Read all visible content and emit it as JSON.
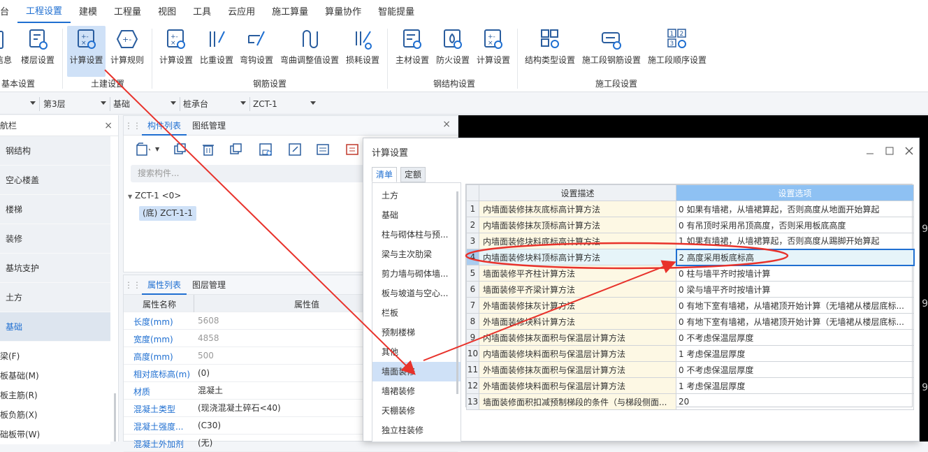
{
  "menubar": [
    "台",
    "工程设置",
    "建模",
    "工程量",
    "视图",
    "工具",
    "云应用",
    "施工算量",
    "算量协作",
    "智能提量"
  ],
  "ribbon": {
    "buttons": [
      "信息",
      "楼层设置",
      "计算设置",
      "计算规则",
      "计算设置",
      "比重设置",
      "弯钩设置",
      "弯曲调整值设置",
      "损耗设置",
      "主材设置",
      "防火设置",
      "计算设置",
      "结构类型设置",
      "施工段钢筋设置",
      "施工段顺序设置"
    ],
    "groups": [
      "基本设置",
      "土建设置",
      "钢筋设置",
      "钢结构设置",
      "施工段设置"
    ]
  },
  "dropdowns": [
    "",
    "第3层",
    "基础",
    "桩承台",
    "ZCT-1"
  ],
  "nav": {
    "title": "航栏",
    "items": [
      "钢结构",
      "空心楼盖",
      "楼梯",
      "装修",
      "基坑支护",
      "土方",
      "基础"
    ],
    "subitems": [
      "梁(F)",
      "板基础(M)",
      "板主筋(R)",
      "板负筋(X)",
      "础板带(W)"
    ]
  },
  "component_panel": {
    "tabs": [
      "构件列表",
      "图纸管理"
    ],
    "search_placeholder": "搜索构件...",
    "tree_root": "ZCT-1 <0>",
    "tree_child": "(底) ZCT-1-1"
  },
  "property_panel": {
    "tabs": [
      "属性列表",
      "图层管理"
    ],
    "headers": [
      "属性名称",
      "属性值"
    ],
    "rows": [
      {
        "name": "长度(mm)",
        "value": "5608"
      },
      {
        "name": "宽度(mm)",
        "value": "4858"
      },
      {
        "name": "高度(mm)",
        "value": "500"
      },
      {
        "name": "相对底标高(m)",
        "value": "(0)"
      },
      {
        "name": "材质",
        "value": "混凝土"
      },
      {
        "name": "混凝土类型",
        "value": "(现浇混凝土碎石<40)"
      },
      {
        "name": "混凝土强度...",
        "value": "(C30)"
      },
      {
        "name": "混凝土外加剂",
        "value": "(无)"
      }
    ]
  },
  "dialog": {
    "title": "计算设置",
    "tabs": [
      "清单",
      "定额"
    ],
    "categories": [
      "土方",
      "基础",
      "柱与砌体柱与预...",
      "梁与主次肋梁",
      "剪力墙与砌体墙...",
      "板与坡道与空心...",
      "栏板",
      "预制楼梯",
      "其他",
      "墙面装修",
      "墙裙装修",
      "天棚装修",
      "独立柱装修"
    ],
    "selected_category": "墙面装修",
    "headers": [
      "设置描述",
      "设置选项"
    ],
    "rows": [
      {
        "n": "1",
        "desc": "内墙面装修抹灰底标高计算方法",
        "opt": "0 如果有墙裙，从墙裙算起，否则高度从地面开始算起"
      },
      {
        "n": "2",
        "desc": "内墙面装修抹灰顶标高计算方法",
        "opt": "0 有吊顶时采用吊顶高度，否则采用板底高度"
      },
      {
        "n": "3",
        "desc": "内墙面装修块料底标高计算方法",
        "opt": "1 如果有墙裙，从墙裙算起，否则高度从踢脚开始算起"
      },
      {
        "n": "4",
        "desc": "内墙面装修块料顶标高计算方法",
        "opt": "2 高度采用板底标高"
      },
      {
        "n": "5",
        "desc": "墙面装修平齐柱计算方法",
        "opt": "0 柱与墙平齐时按墙计算"
      },
      {
        "n": "6",
        "desc": "墙面装修平齐梁计算方法",
        "opt": "0 梁与墙平齐时按墙计算"
      },
      {
        "n": "7",
        "desc": "外墙面装修抹灰计算方法",
        "opt": "0 有地下室有墙裙，从墙裙顶开始计算（无墙裙从楼层底标..."
      },
      {
        "n": "8",
        "desc": "外墙面装修块料计算方法",
        "opt": "0 有地下室有墙裙，从墙裙顶开始计算（无墙裙从楼层底标..."
      },
      {
        "n": "9",
        "desc": "内墙面装修抹灰面积与保温层计算方法",
        "opt": "0 不考虑保温层厚度"
      },
      {
        "n": "10",
        "desc": "内墙面装修块料面积与保温层计算方法",
        "opt": "1 考虑保温层厚度"
      },
      {
        "n": "11",
        "desc": "外墙面装修抹灰面积与保温层计算方法",
        "opt": "0 不考虑保温层厚度"
      },
      {
        "n": "12",
        "desc": "外墙面装修块料面积与保温层计算方法",
        "opt": "1 考虑保温层厚度"
      },
      {
        "n": "13",
        "desc": "墙面装修面积扣减预制梯段的条件（与梯段侧面...",
        "opt": "20"
      }
    ],
    "selected_row": "4"
  },
  "canvas": {
    "edge_label": "9"
  },
  "colors": {
    "accent": "#1f6fd1",
    "annotation": "#e8322b",
    "selection": "#cfe1f7"
  }
}
